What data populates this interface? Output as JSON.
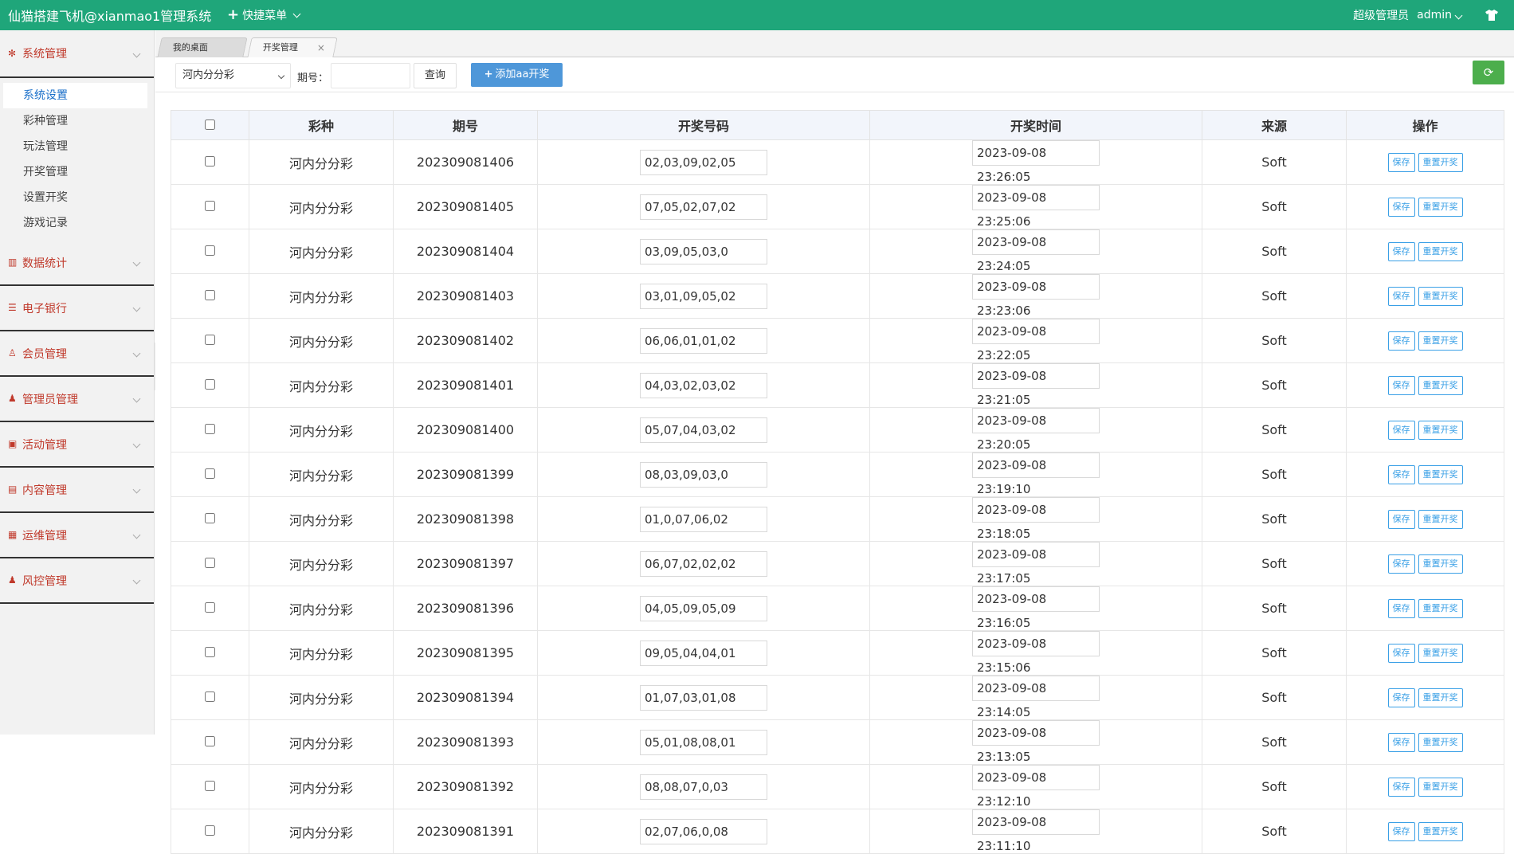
{
  "header": {
    "title": "仙猫搭建飞机@xianmao1管理系统",
    "quick_menu": "快捷菜单",
    "role": "超级管理员",
    "user": "admin"
  },
  "sidebar": {
    "groups": [
      {
        "label": "系统管理",
        "icon": "gear-icon",
        "items": [
          "系统设置",
          "彩种管理",
          "玩法管理",
          "开奖管理",
          "设置开奖",
          "游戏记录"
        ],
        "active": "系统设置"
      },
      {
        "label": "数据统计",
        "icon": "bar-chart-icon"
      },
      {
        "label": "电子银行",
        "icon": "list-icon"
      },
      {
        "label": "会员管理",
        "icon": "user-icon"
      },
      {
        "label": "管理员管理",
        "icon": "admin-user-icon"
      },
      {
        "label": "活动管理",
        "icon": "gift-icon"
      },
      {
        "label": "内容管理",
        "icon": "news-icon"
      },
      {
        "label": "运维管理",
        "icon": "server-icon"
      },
      {
        "label": "风控管理",
        "icon": "shield-user-icon"
      }
    ]
  },
  "tabs": [
    "我的桌面",
    "开奖管理"
  ],
  "toolbar": {
    "lottery_select": "河内分分彩",
    "issue_label": "期号：",
    "issue_value": "",
    "query_button": "查询",
    "add_button": "添加aa开奖"
  },
  "table": {
    "headers": [
      "彩种",
      "期号",
      "开奖号码",
      "开奖时间",
      "来源",
      "操作"
    ],
    "save_label": "保存",
    "reset_label": "重置开奖",
    "rows": [
      {
        "lottery": "河内分分彩",
        "issue": "202309081406",
        "numbers": "02,03,09,02,05",
        "time": "2023-09-08 23:26:05",
        "source": "Soft"
      },
      {
        "lottery": "河内分分彩",
        "issue": "202309081405",
        "numbers": "07,05,02,07,02",
        "time": "2023-09-08 23:25:06",
        "source": "Soft"
      },
      {
        "lottery": "河内分分彩",
        "issue": "202309081404",
        "numbers": "03,09,05,03,0",
        "time": "2023-09-08 23:24:05",
        "source": "Soft"
      },
      {
        "lottery": "河内分分彩",
        "issue": "202309081403",
        "numbers": "03,01,09,05,02",
        "time": "2023-09-08 23:23:06",
        "source": "Soft"
      },
      {
        "lottery": "河内分分彩",
        "issue": "202309081402",
        "numbers": "06,06,01,01,02",
        "time": "2023-09-08 23:22:05",
        "source": "Soft"
      },
      {
        "lottery": "河内分分彩",
        "issue": "202309081401",
        "numbers": "04,03,02,03,02",
        "time": "2023-09-08 23:21:05",
        "source": "Soft"
      },
      {
        "lottery": "河内分分彩",
        "issue": "202309081400",
        "numbers": "05,07,04,03,02",
        "time": "2023-09-08 23:20:05",
        "source": "Soft"
      },
      {
        "lottery": "河内分分彩",
        "issue": "202309081399",
        "numbers": "08,03,09,03,0",
        "time": "2023-09-08 23:19:10",
        "source": "Soft"
      },
      {
        "lottery": "河内分分彩",
        "issue": "202309081398",
        "numbers": "01,0,07,06,02",
        "time": "2023-09-08 23:18:05",
        "source": "Soft"
      },
      {
        "lottery": "河内分分彩",
        "issue": "202309081397",
        "numbers": "06,07,02,02,02",
        "time": "2023-09-08 23:17:05",
        "source": "Soft"
      },
      {
        "lottery": "河内分分彩",
        "issue": "202309081396",
        "numbers": "04,05,09,05,09",
        "time": "2023-09-08 23:16:05",
        "source": "Soft"
      },
      {
        "lottery": "河内分分彩",
        "issue": "202309081395",
        "numbers": "09,05,04,04,01",
        "time": "2023-09-08 23:15:06",
        "source": "Soft"
      },
      {
        "lottery": "河内分分彩",
        "issue": "202309081394",
        "numbers": "01,07,03,01,08",
        "time": "2023-09-08 23:14:05",
        "source": "Soft"
      },
      {
        "lottery": "河内分分彩",
        "issue": "202309081393",
        "numbers": "05,01,08,08,01",
        "time": "2023-09-08 23:13:05",
        "source": "Soft"
      },
      {
        "lottery": "河内分分彩",
        "issue": "202309081392",
        "numbers": "08,08,07,0,03",
        "time": "2023-09-08 23:12:10",
        "source": "Soft"
      },
      {
        "lottery": "河内分分彩",
        "issue": "202309081391",
        "numbers": "02,07,06,0,08",
        "time": "2023-09-08 23:11:10",
        "source": "Soft"
      }
    ]
  }
}
